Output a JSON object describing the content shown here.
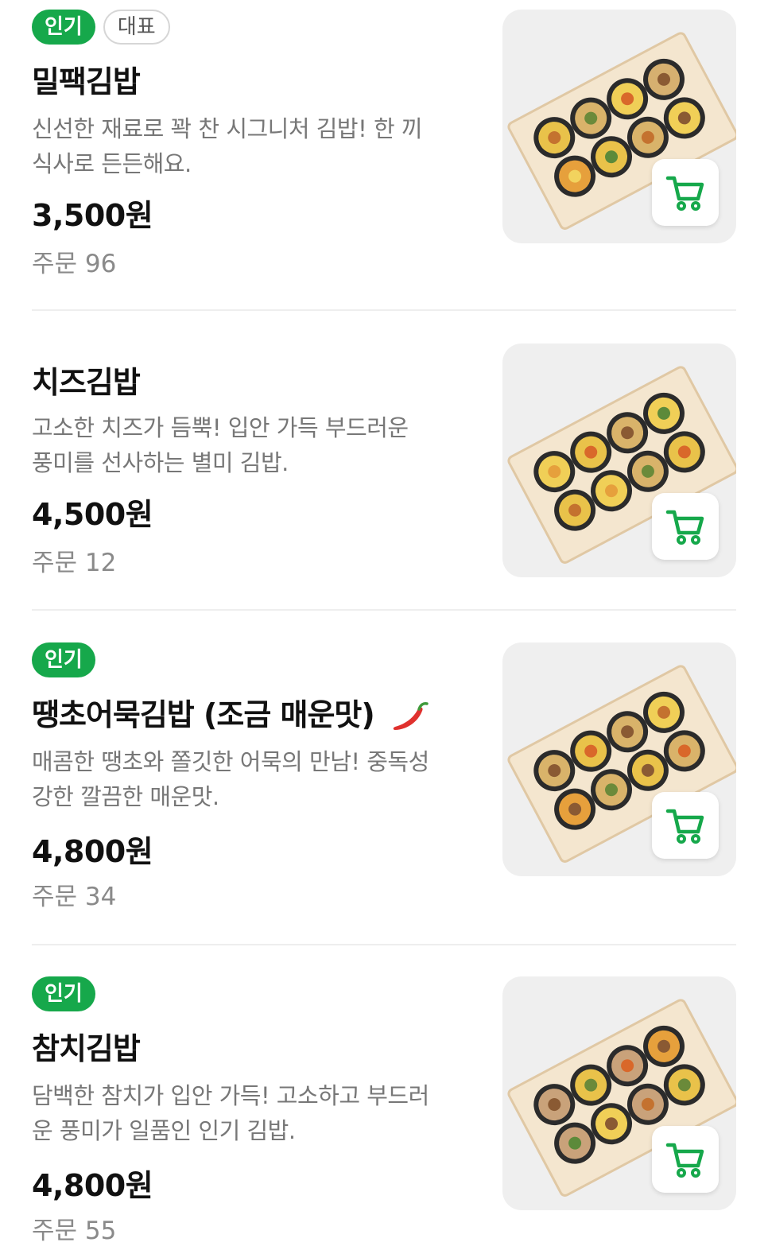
{
  "colors": {
    "accent": "#16a84b",
    "text": "#111111",
    "muted": "#777777"
  },
  "menu": [
    {
      "badges": [
        "인기",
        "대표"
      ],
      "name": "밀팩김밥",
      "desc_line1": "신선한 재료로 꽉 찬 시그니처 김밥! 한 끼",
      "desc_line2": "식사로 든든해요.",
      "price": "3,500원",
      "orders_label": "주문 96",
      "image_icon": "kimbap-photo",
      "cart_icon": "cart-icon"
    },
    {
      "badges": [],
      "name": "치즈김밥",
      "desc_line1": "고소한 치즈가 듬뿍! 입안 가득 부드러운",
      "desc_line2": "풍미를 선사하는 별미 김밥.",
      "price": "4,500원",
      "orders_label": "주문 12",
      "image_icon": "kimbap-photo",
      "cart_icon": "cart-icon"
    },
    {
      "badges": [
        "인기"
      ],
      "name": "땡초어묵김밥 (조금 매운맛)",
      "name_icon": "chili-pepper-icon",
      "desc_line1": "매콤한 땡초와 쫄깃한 어묵의 만남! 중독성",
      "desc_line2": "강한 깔끔한 매운맛.",
      "price": "4,800원",
      "orders_label": "주문 34",
      "image_icon": "kimbap-photo",
      "cart_icon": "cart-icon"
    },
    {
      "badges": [
        "인기"
      ],
      "name": "참치김밥",
      "desc_line1": "담백한 참치가 입안 가득! 고소하고 부드러",
      "desc_line2": "운 풍미가 일품인 인기 김밥.",
      "price": "4,800원",
      "orders_label": "주문 55",
      "image_icon": "kimbap-photo",
      "cart_icon": "cart-icon"
    }
  ]
}
